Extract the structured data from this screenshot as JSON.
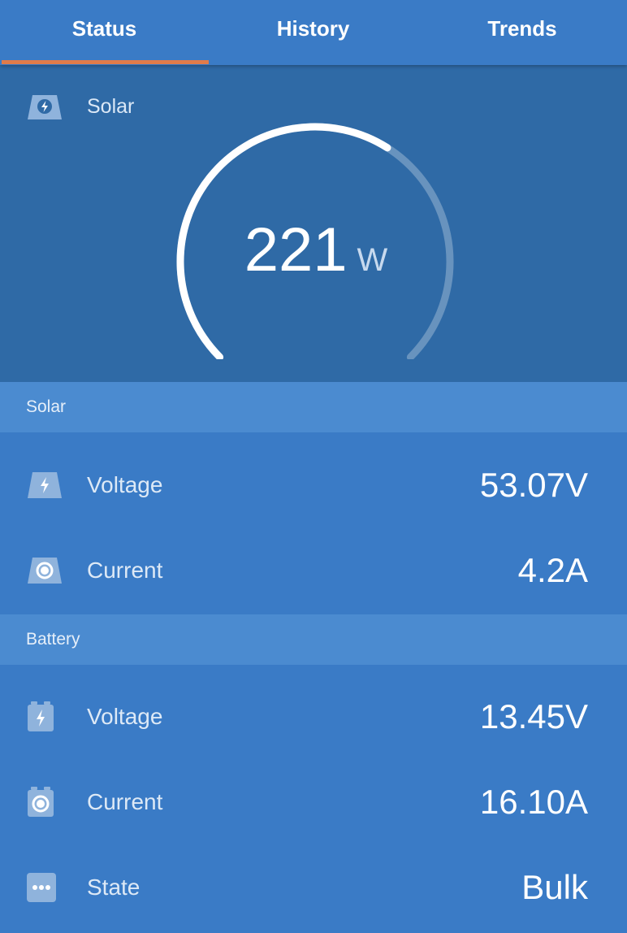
{
  "tabs": [
    {
      "label": "Status",
      "active": true
    },
    {
      "label": "History",
      "active": false
    },
    {
      "label": "Trends",
      "active": false
    }
  ],
  "hero": {
    "icon": "solar-panel-bolt-icon",
    "label": "Solar",
    "power_value": "221",
    "power_unit": "W",
    "gauge_fraction": 0.62
  },
  "solar_section": {
    "title": "Solar",
    "rows": [
      {
        "icon": "solar-voltage-icon",
        "label": "Voltage",
        "value": "53.07V"
      },
      {
        "icon": "solar-current-icon",
        "label": "Current",
        "value": "4.2A"
      }
    ]
  },
  "battery_section": {
    "title": "Battery",
    "rows": [
      {
        "icon": "battery-voltage-icon",
        "label": "Voltage",
        "value": "13.45V"
      },
      {
        "icon": "battery-current-icon",
        "label": "Current",
        "value": "16.10A"
      },
      {
        "icon": "state-dots-icon",
        "label": "State",
        "value": "Bulk"
      }
    ]
  },
  "colors": {
    "background": "#3a7bc6",
    "hero": "#2f6aa6",
    "section_header": "#4b8bd0",
    "tab_indicator": "#e07b4a"
  }
}
